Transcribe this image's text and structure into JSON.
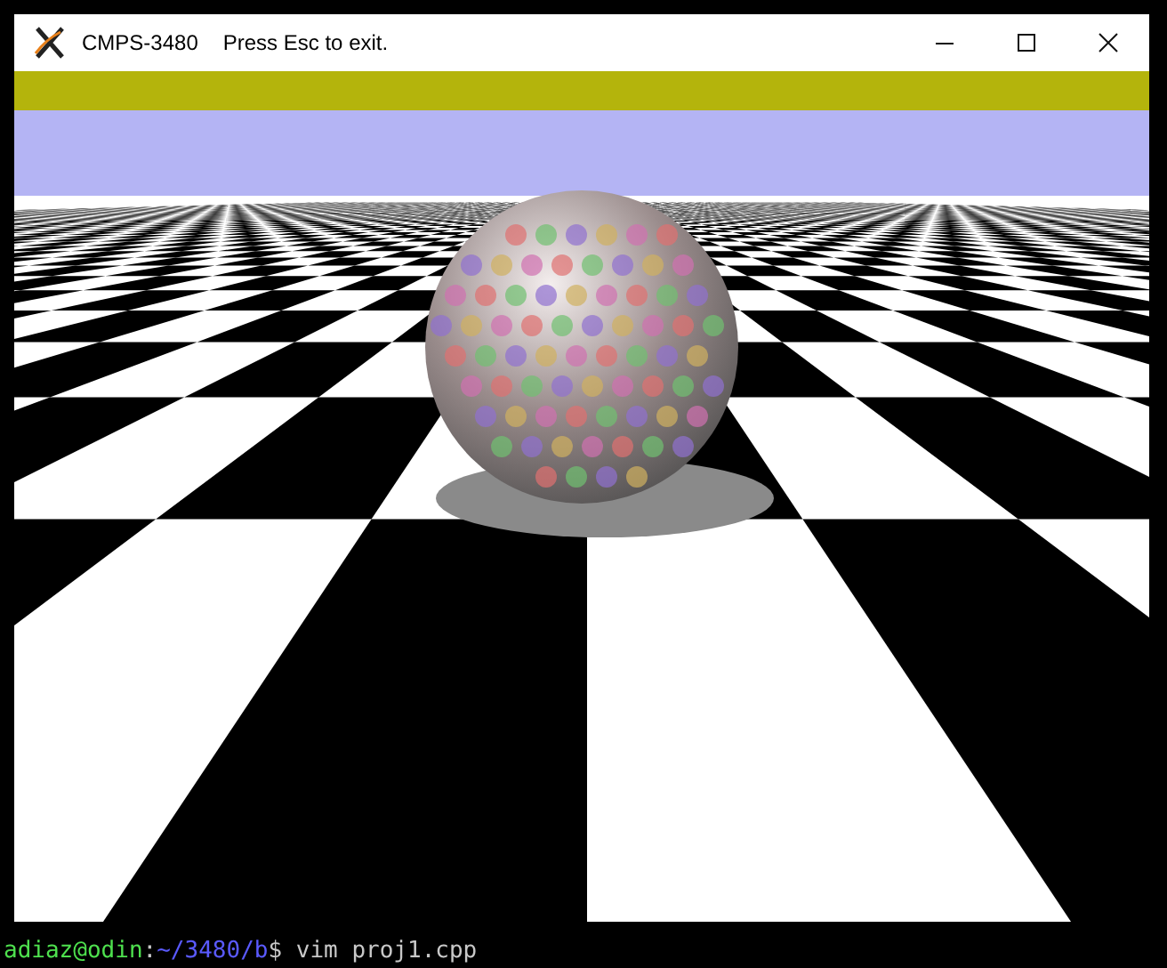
{
  "window": {
    "title": "CMPS-3480",
    "hint": "Press Esc to exit."
  },
  "terminal": {
    "prompt": [
      {
        "kind": "user",
        "text": "adiaz@odin"
      },
      {
        "kind": "sep",
        "text": ":"
      },
      {
        "kind": "path",
        "text": "~/3480/b"
      },
      {
        "kind": "cmd",
        "text": "$ vim proj1.cpp"
      }
    ]
  }
}
